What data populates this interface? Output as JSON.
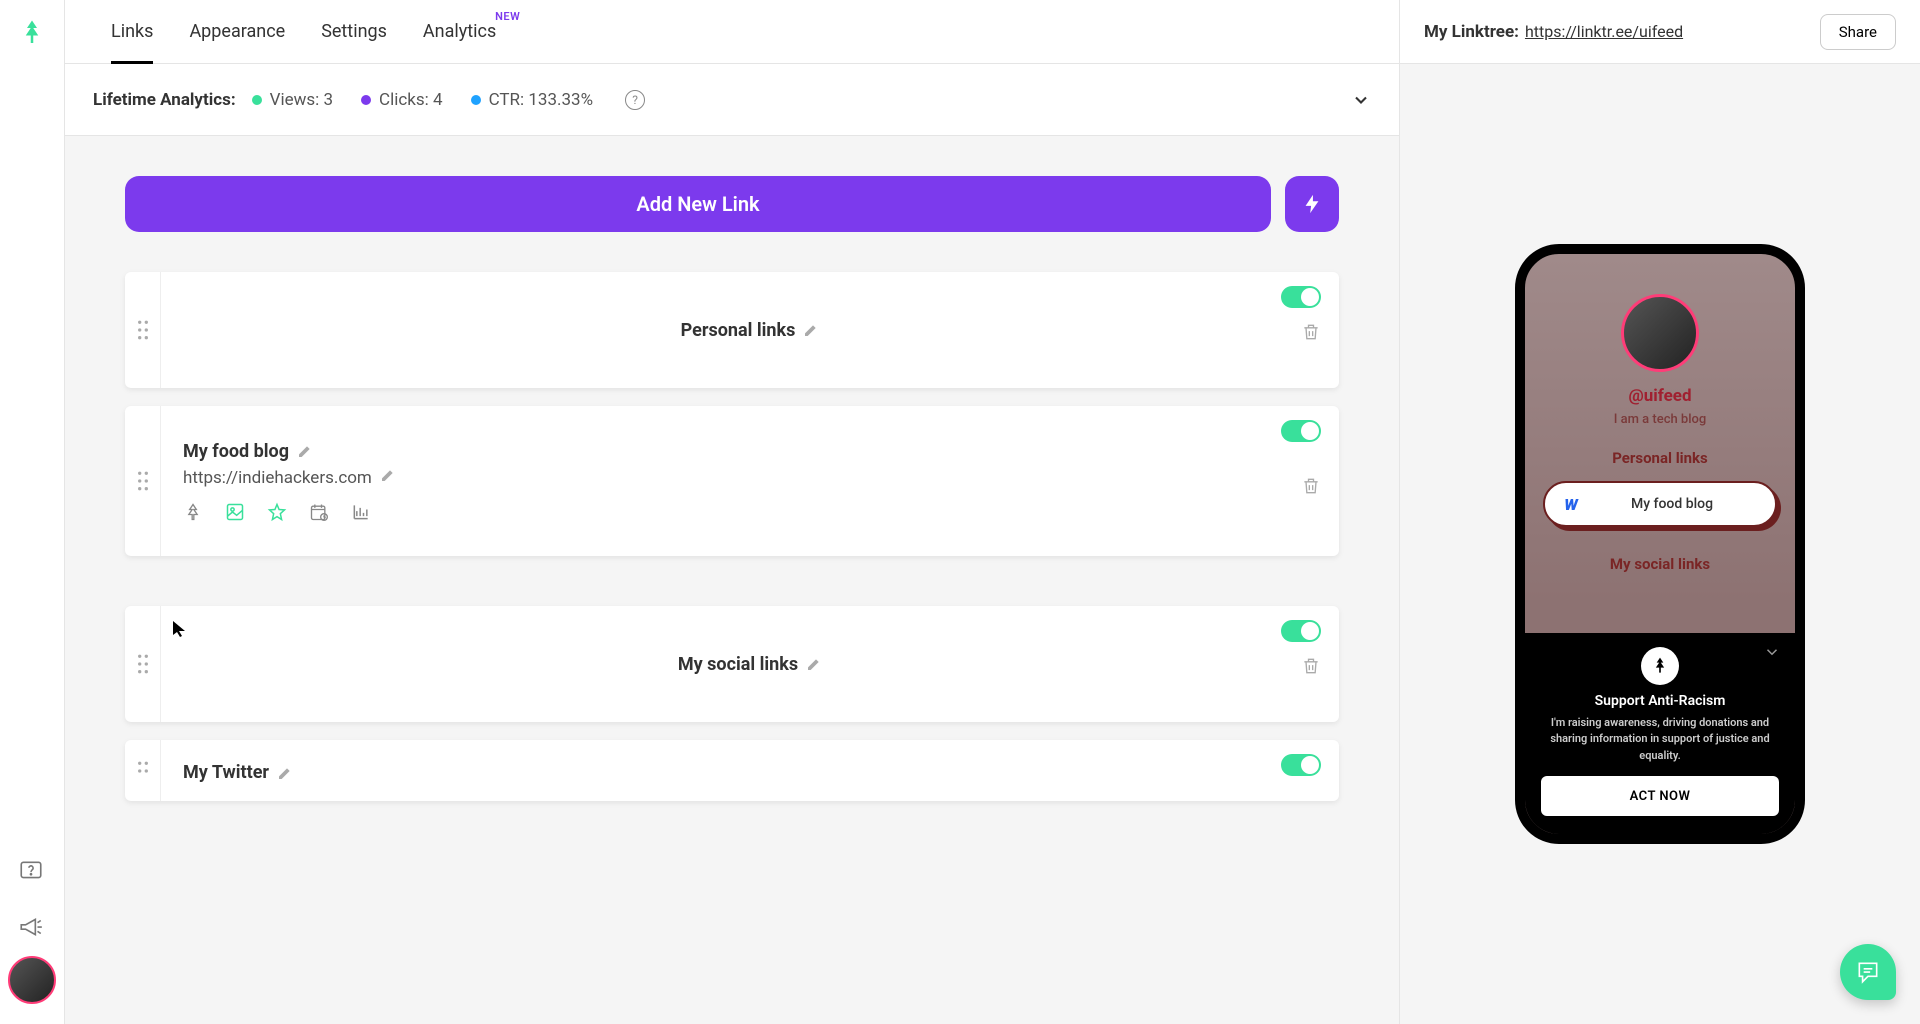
{
  "tabs": {
    "links": "Links",
    "appearance": "Appearance",
    "settings": "Settings",
    "analytics": "Analytics",
    "new_badge": "NEW"
  },
  "analytics": {
    "label": "Lifetime Analytics:",
    "views": "Views: 3",
    "clicks": "Clicks: 4",
    "ctr": "CTR: 133.33%"
  },
  "buttons": {
    "add_link": "Add New Link",
    "share": "Share",
    "act_now": "ACT NOW"
  },
  "links": {
    "section1_title": "Personal links",
    "link1_title": "My food blog",
    "link1_url": "https://indiehackers.com",
    "section2_title": "My social links",
    "link2_title": "My Twitter"
  },
  "preview_header": {
    "label": "My Linktree:",
    "url": "https://linktr.ee/uifeed"
  },
  "phone": {
    "handle": "@uifeed",
    "bio": "I am a tech blog",
    "section1": "Personal links",
    "link1": "My food blog",
    "section2": "My social links"
  },
  "banner": {
    "title": "Support Anti-Racism",
    "desc": "I'm raising awareness, driving donations and sharing information in support of justice and equality."
  }
}
